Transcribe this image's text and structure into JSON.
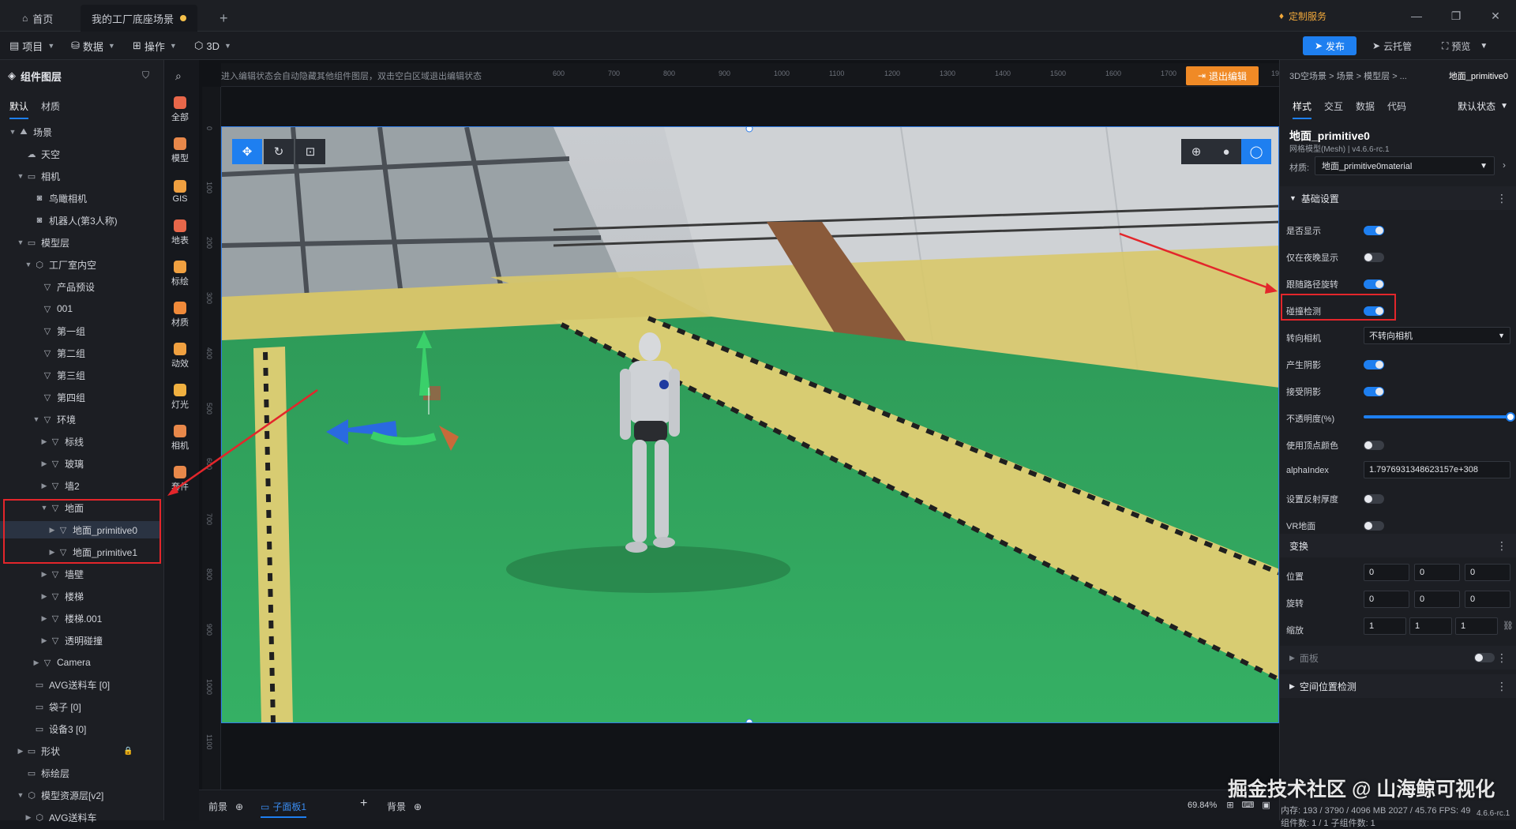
{
  "tabs": [
    {
      "label": "首页"
    },
    {
      "label": "我的工厂底座场景",
      "unsaved": true
    }
  ],
  "custom_service": "定制服务",
  "menus": [
    "项目",
    "数据",
    "操作",
    "3D"
  ],
  "actions": {
    "publish": "发布",
    "cloud": "云托管",
    "preview": "预览"
  },
  "left": {
    "title": "组件图层",
    "tabs": [
      "默认",
      "材质"
    ],
    "tree": [
      {
        "label": "场景",
        "depth": 0,
        "arrow": "down",
        "icon": "scene-icon"
      },
      {
        "label": "天空",
        "depth": 1,
        "arrow": "",
        "icon": "sky-icon"
      },
      {
        "label": "相机",
        "depth": 1,
        "arrow": "down",
        "icon": "folder-icon"
      },
      {
        "label": "鸟瞰相机",
        "depth": 2,
        "arrow": "",
        "icon": "camera-icon"
      },
      {
        "label": "机器人(第3人称)",
        "depth": 2,
        "arrow": "",
        "icon": "camera-icon"
      },
      {
        "label": "模型层",
        "depth": 1,
        "arrow": "down",
        "icon": "folder-icon"
      },
      {
        "label": "工厂室内空",
        "depth": 2,
        "arrow": "down",
        "icon": "model-icon"
      },
      {
        "label": "产品预设",
        "depth": 3,
        "arrow": "",
        "icon": "mesh-icon"
      },
      {
        "label": "001",
        "depth": 3,
        "arrow": "",
        "icon": "mesh-icon"
      },
      {
        "label": "第一组",
        "depth": 3,
        "arrow": "",
        "icon": "mesh-icon"
      },
      {
        "label": "第二组",
        "depth": 3,
        "arrow": "",
        "icon": "mesh-icon"
      },
      {
        "label": "第三组",
        "depth": 3,
        "arrow": "",
        "icon": "mesh-icon"
      },
      {
        "label": "第四组",
        "depth": 3,
        "arrow": "",
        "icon": "mesh-icon"
      },
      {
        "label": "环境",
        "depth": 3,
        "arrow": "down",
        "icon": "mesh-icon"
      },
      {
        "label": "标线",
        "depth": 4,
        "arrow": "right",
        "icon": "mesh-icon"
      },
      {
        "label": "玻璃",
        "depth": 4,
        "arrow": "right",
        "icon": "mesh-icon"
      },
      {
        "label": "墙2",
        "depth": 4,
        "arrow": "right",
        "icon": "mesh-icon"
      },
      {
        "label": "地面",
        "depth": 4,
        "arrow": "down",
        "icon": "mesh-icon"
      },
      {
        "label": "地面_primitive0",
        "depth": 5,
        "arrow": "right",
        "icon": "mesh-icon",
        "selected": true
      },
      {
        "label": "地面_primitive1",
        "depth": 5,
        "arrow": "right",
        "icon": "mesh-icon"
      },
      {
        "label": "墙壁",
        "depth": 4,
        "arrow": "right",
        "icon": "mesh-icon"
      },
      {
        "label": "楼梯",
        "depth": 4,
        "arrow": "right",
        "icon": "mesh-icon"
      },
      {
        "label": "楼梯.001",
        "depth": 4,
        "arrow": "right",
        "icon": "mesh-icon"
      },
      {
        "label": "透明碰撞",
        "depth": 4,
        "arrow": "right",
        "icon": "mesh-icon"
      },
      {
        "label": "Camera",
        "depth": 3,
        "arrow": "right",
        "icon": "mesh-icon"
      },
      {
        "label": "AVG送料车 [0]",
        "depth": 2,
        "arrow": "",
        "icon": "folder-icon"
      },
      {
        "label": "袋子 [0]",
        "depth": 2,
        "arrow": "",
        "icon": "folder-icon"
      },
      {
        "label": "设备3 [0]",
        "depth": 2,
        "arrow": "",
        "icon": "folder-icon"
      },
      {
        "label": "形状",
        "depth": 1,
        "arrow": "right",
        "icon": "folder-icon",
        "locked": true
      },
      {
        "label": "标绘层",
        "depth": 1,
        "arrow": "",
        "icon": "folder-icon"
      },
      {
        "label": "模型资源层[v2]",
        "depth": 1,
        "arrow": "down",
        "icon": "model-icon"
      },
      {
        "label": "AVG送料车",
        "depth": 2,
        "arrow": "right",
        "icon": "model-icon"
      }
    ]
  },
  "rail": [
    {
      "label": "全部",
      "color": "#e8674a"
    },
    {
      "label": "模型",
      "color": "#e8884a"
    },
    {
      "label": "GIS",
      "color": "#f0a040"
    },
    {
      "label": "地表",
      "color": "#e8674a"
    },
    {
      "label": "标绘",
      "color": "#f0a040"
    },
    {
      "label": "材质",
      "color": "#f08a3a"
    },
    {
      "label": "动效",
      "color": "#f0a040"
    },
    {
      "label": "灯光",
      "color": "#f0b040"
    },
    {
      "label": "相机",
      "color": "#e8884a"
    },
    {
      "label": "套件",
      "color": "#e8884a"
    }
  ],
  "canvas": {
    "hint": "进入编辑状态会自动隐藏其他组件图层，双击空白区域退出编辑状态",
    "exit_edit": "退出编辑",
    "ruler_top": [
      "600",
      "700",
      "800",
      "900",
      "1000",
      "1100",
      "1200",
      "1300",
      "1400",
      "1500",
      "1600",
      "1700",
      "1800",
      "1900"
    ],
    "ruler_left": [
      "0",
      "100",
      "200",
      "300",
      "400",
      "500",
      "600",
      "700",
      "800",
      "900",
      "1000",
      "1100"
    ]
  },
  "bottom": {
    "front": "前景",
    "subpanel": "子面板1",
    "back": "背景",
    "zoom": "69.84%"
  },
  "status": {
    "line1": "内存: 193 / 3790 / 4096 MB  2027 / 45.76  FPS: 49",
    "line2": "组件数: 1 / 1   子组件数: 1",
    "version_right": "4.6.6-rc.1"
  },
  "right": {
    "breadcrumb": "3D空场景 > 场景 > 模型层 > ...",
    "current": "地面_primitive0",
    "tabs": [
      "样式",
      "交互",
      "数据",
      "代码"
    ],
    "state": "默认状态",
    "name": "地面_primitive0",
    "type": "网格模型(Mesh) | v4.6.6-rc.1",
    "material_label": "材质:",
    "material": "地面_primitive0material",
    "basic_title": "基础设置",
    "props": [
      {
        "label": "是否显示",
        "on": true
      },
      {
        "label": "仅在夜晚显示",
        "on": false
      },
      {
        "label": "跟随路径旋转",
        "on": true
      },
      {
        "label": "碰撞检测",
        "on": true
      },
      {
        "label": "转向相机",
        "select": "不转向相机"
      },
      {
        "label": "产生阴影",
        "on": true
      },
      {
        "label": "接受阴影",
        "on": true
      },
      {
        "label": "不透明度(%)",
        "slider": 1.0
      },
      {
        "label": "使用顶点颜色",
        "on": false
      },
      {
        "label": "alphaIndex",
        "value": "1.7976931348623157e+308"
      },
      {
        "label": "设置反射厚度",
        "on": false
      },
      {
        "label": "VR地面",
        "on": false
      }
    ],
    "transform_title": "变换",
    "position_label": "位置",
    "position": [
      "0",
      "0",
      "0"
    ],
    "rotation_label": "旋转",
    "rotation": [
      "0",
      "0",
      "0"
    ],
    "scale_label": "缩放",
    "scale": [
      "1",
      "1",
      "1"
    ],
    "panel_title": "面板",
    "spatial_title": "空间位置检测"
  },
  "watermark": "掘金技术社区 @ 山海鲸可视化",
  "colors": {
    "accent": "#1e7ff0",
    "exit": "#f08a26",
    "highlight": "#e3262b",
    "floor_green": "#2ea65a"
  }
}
